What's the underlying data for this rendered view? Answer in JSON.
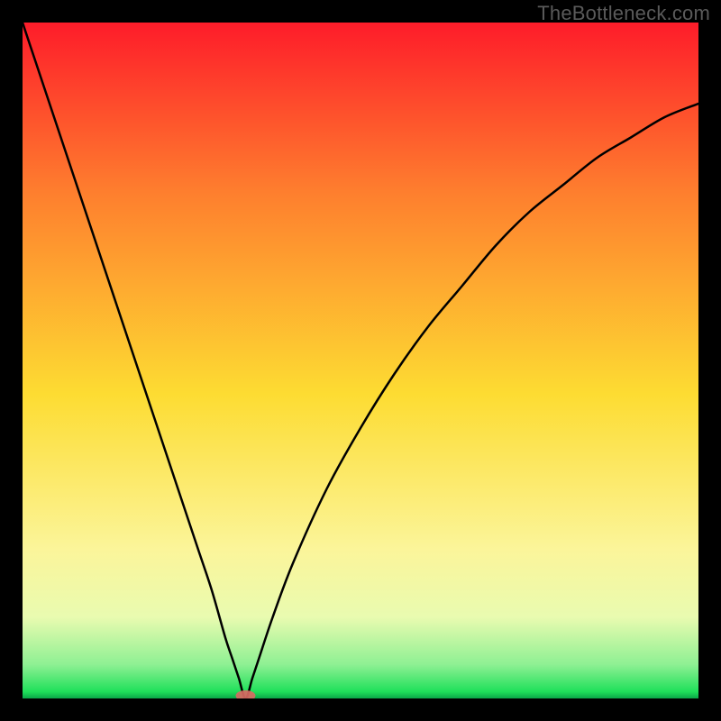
{
  "watermark": "TheBottleneck.com",
  "colors": {
    "top": "#fe1c2a",
    "upper_mid": "#fe7e2e",
    "mid": "#fddc32",
    "lower_mid": "#fbf59a",
    "pale": "#e9fbb0",
    "green": "#1fe05a",
    "darkgreen": "#0aa648",
    "curve": "#000000",
    "frame": "#000000",
    "marker": "#d86a63"
  },
  "chart_data": {
    "type": "line",
    "title": "",
    "xlabel": "",
    "ylabel": "",
    "xlim": [
      0,
      100
    ],
    "ylim": [
      0,
      100
    ],
    "minimum_x": 33,
    "marker": {
      "x": 33,
      "y": 0
    },
    "series": [
      {
        "name": "bottleneck-curve",
        "x": [
          0,
          2,
          4,
          6,
          8,
          10,
          12,
          14,
          16,
          18,
          20,
          22,
          24,
          26,
          28,
          30,
          31,
          32,
          33,
          34,
          35,
          37,
          40,
          45,
          50,
          55,
          60,
          65,
          70,
          75,
          80,
          85,
          90,
          95,
          100
        ],
        "y": [
          100,
          94,
          88,
          82,
          76,
          70,
          64,
          58,
          52,
          46,
          40,
          34,
          28,
          22,
          16,
          9,
          6,
          3,
          0,
          3,
          6,
          12,
          20,
          31,
          40,
          48,
          55,
          61,
          67,
          72,
          76,
          80,
          83,
          86,
          88
        ]
      }
    ],
    "gradient_stops": [
      {
        "offset": 0,
        "color": "#fe1c2a"
      },
      {
        "offset": 25,
        "color": "#fe7e2e"
      },
      {
        "offset": 55,
        "color": "#fddc32"
      },
      {
        "offset": 78,
        "color": "#fbf59a"
      },
      {
        "offset": 88,
        "color": "#e9fbb0"
      },
      {
        "offset": 95,
        "color": "#8ef093"
      },
      {
        "offset": 99,
        "color": "#1fe05a"
      },
      {
        "offset": 100,
        "color": "#0aa648"
      }
    ]
  }
}
